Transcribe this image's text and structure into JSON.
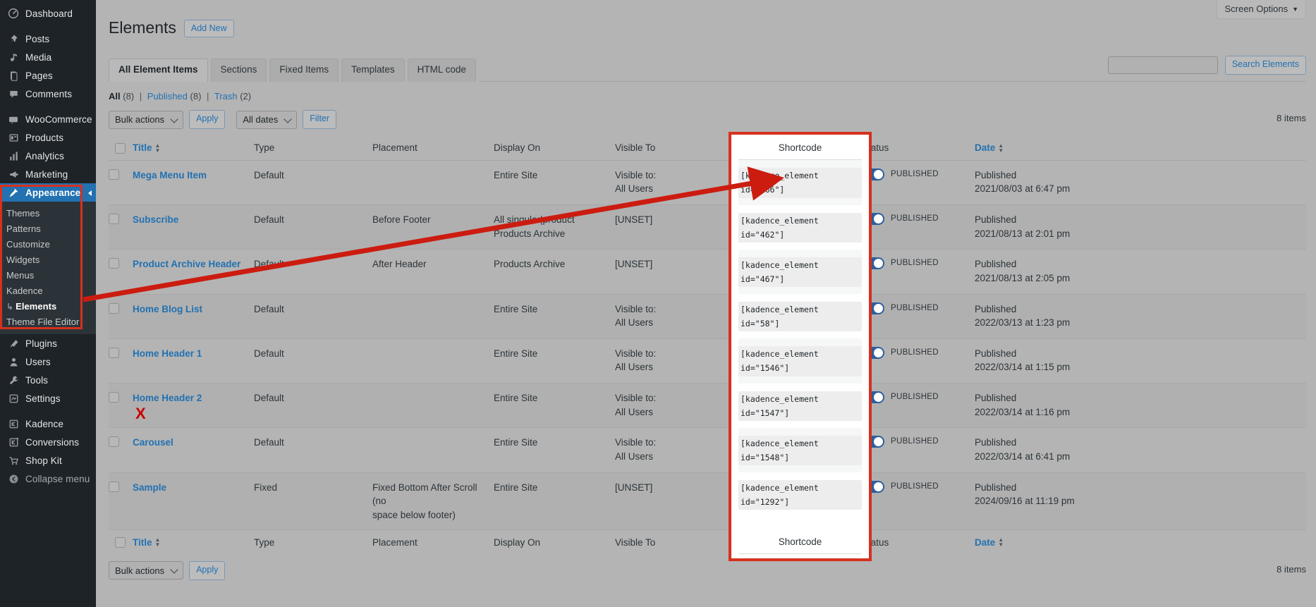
{
  "sidebar": {
    "items": [
      {
        "label": "Dashboard",
        "icon": "dashboard-icon"
      },
      {
        "label": "Posts",
        "icon": "pin-icon"
      },
      {
        "label": "Media",
        "icon": "media-icon"
      },
      {
        "label": "Pages",
        "icon": "pages-icon"
      },
      {
        "label": "Comments",
        "icon": "comments-icon"
      },
      {
        "label": "WooCommerce",
        "icon": "woocommerce-icon"
      },
      {
        "label": "Products",
        "icon": "products-icon"
      },
      {
        "label": "Analytics",
        "icon": "analytics-icon"
      },
      {
        "label": "Marketing",
        "icon": "marketing-icon"
      },
      {
        "label": "Appearance",
        "icon": "appearance-icon"
      },
      {
        "label": "Plugins",
        "icon": "plugins-icon"
      },
      {
        "label": "Users",
        "icon": "users-icon"
      },
      {
        "label": "Tools",
        "icon": "tools-icon"
      },
      {
        "label": "Settings",
        "icon": "settings-icon"
      },
      {
        "label": "Kadence",
        "icon": "kadence-icon"
      },
      {
        "label": "Conversions",
        "icon": "conversions-icon"
      },
      {
        "label": "Shop Kit",
        "icon": "shop-kit-icon"
      },
      {
        "label": "Collapse menu",
        "icon": "collapse-icon"
      }
    ],
    "appearance_submenu": [
      {
        "label": "Themes"
      },
      {
        "label": "Patterns"
      },
      {
        "label": "Customize"
      },
      {
        "label": "Widgets"
      },
      {
        "label": "Menus"
      },
      {
        "label": "Kadence"
      },
      {
        "label": "Elements",
        "current": true,
        "arrow": "↳"
      },
      {
        "label": "Theme File Editor"
      }
    ]
  },
  "header": {
    "screen_options": "Screen Options",
    "screen_options_caret": "▼",
    "page_title": "Elements",
    "add_new": "Add New"
  },
  "tabs": [
    {
      "label": "All Element Items",
      "active": true
    },
    {
      "label": "Sections",
      "active": false
    },
    {
      "label": "Fixed Items",
      "active": false
    },
    {
      "label": "Templates",
      "active": false
    },
    {
      "label": "HTML code",
      "active": false
    }
  ],
  "subsubsub": {
    "all_label": "All",
    "all_count": "(8)",
    "published_label": "Published",
    "published_count": "(8)",
    "trash_label": "Trash",
    "trash_count": "(2)",
    "separator": "|"
  },
  "search": {
    "value": "",
    "placeholder": "",
    "submit_label": "Search Elements"
  },
  "tablenav": {
    "bulk_actions": "Bulk actions",
    "apply": "Apply",
    "all_dates": "All dates",
    "filter": "Filter",
    "items_count": "8 items",
    "items_count_bottom": "8 items"
  },
  "table": {
    "columns": [
      {
        "key": "title",
        "label": "Title",
        "sortable": true
      },
      {
        "key": "type",
        "label": "Type",
        "sortable": false
      },
      {
        "key": "placement",
        "label": "Placement",
        "sortable": false
      },
      {
        "key": "display_on",
        "label": "Display On",
        "sortable": false
      },
      {
        "key": "visible_to",
        "label": "Visible To",
        "sortable": false
      },
      {
        "key": "shortcode",
        "label": "Shortcode",
        "sortable": false
      },
      {
        "key": "status",
        "label": "Status",
        "sortable": false
      },
      {
        "key": "date",
        "label": "Date",
        "sortable": true
      }
    ],
    "rows": [
      {
        "title": "Mega Menu Item",
        "type": "Default",
        "placement": "",
        "display_on": "Entire Site",
        "visible_to": "Visible to:\nAll Users",
        "shortcode": "[kadence_element id=\"166\"]",
        "status_toggle": "on",
        "status_label": "PUBLISHED",
        "date": "Published\n2021/08/03 at 6:47 pm"
      },
      {
        "title": "Subscribe",
        "type": "Default",
        "placement": "Before Footer",
        "display_on": "All singular|product\nProducts Archive",
        "visible_to": "[UNSET]",
        "shortcode": "[kadence_element id=\"462\"]",
        "status_toggle": "on",
        "status_label": "PUBLISHED",
        "date": "Published\n2021/08/13 at 2:01 pm"
      },
      {
        "title": "Product Archive Header",
        "type": "Default",
        "placement": "After Header",
        "display_on": "Products Archive",
        "visible_to": "[UNSET]",
        "shortcode": "[kadence_element id=\"467\"]",
        "status_toggle": "on",
        "status_label": "PUBLISHED",
        "date": "Published\n2021/08/13 at 2:05 pm"
      },
      {
        "title": "Home Blog List",
        "type": "Default",
        "placement": "",
        "display_on": "Entire Site",
        "visible_to": "Visible to:\nAll Users",
        "shortcode": "[kadence_element id=\"58\"]",
        "status_toggle": "on",
        "status_label": "PUBLISHED",
        "date": "Published\n2022/03/13 at 1:23 pm"
      },
      {
        "title": "Home Header 1",
        "type": "Default",
        "placement": "",
        "display_on": "Entire Site",
        "visible_to": "Visible to:\nAll Users",
        "shortcode": "[kadence_element id=\"1546\"]",
        "status_toggle": "on",
        "status_label": "PUBLISHED",
        "date": "Published\n2022/03/14 at 1:15 pm"
      },
      {
        "title": "Home Header 2",
        "type": "Default",
        "placement": "",
        "display_on": "Entire Site",
        "visible_to": "Visible to:\nAll Users",
        "shortcode": "[kadence_element id=\"1547\"]",
        "status_toggle": "on",
        "status_label": "PUBLISHED",
        "date": "Published\n2022/03/14 at 1:16 pm"
      },
      {
        "title": "Carousel",
        "type": "Default",
        "placement": "",
        "display_on": "Entire Site",
        "visible_to": "Visible to:\nAll Users",
        "shortcode": "[kadence_element id=\"1548\"]",
        "status_toggle": "on",
        "status_label": "PUBLISHED",
        "date": "Published\n2022/03/14 at 6:41 pm"
      },
      {
        "title": "Sample",
        "type": "Fixed",
        "placement": "Fixed Bottom After Scroll (no\nspace below footer)",
        "display_on": "Entire Site",
        "visible_to": "[UNSET]",
        "shortcode": "[kadence_element id=\"1292\"]",
        "status_toggle": "on",
        "status_label": "PUBLISHED",
        "date": "Published\n2024/09/16 at 11:19 pm"
      }
    ]
  },
  "annotations": {
    "x_mark": "X",
    "highlight_color": "#d7301d",
    "arrow_color": "#cc1c10"
  }
}
